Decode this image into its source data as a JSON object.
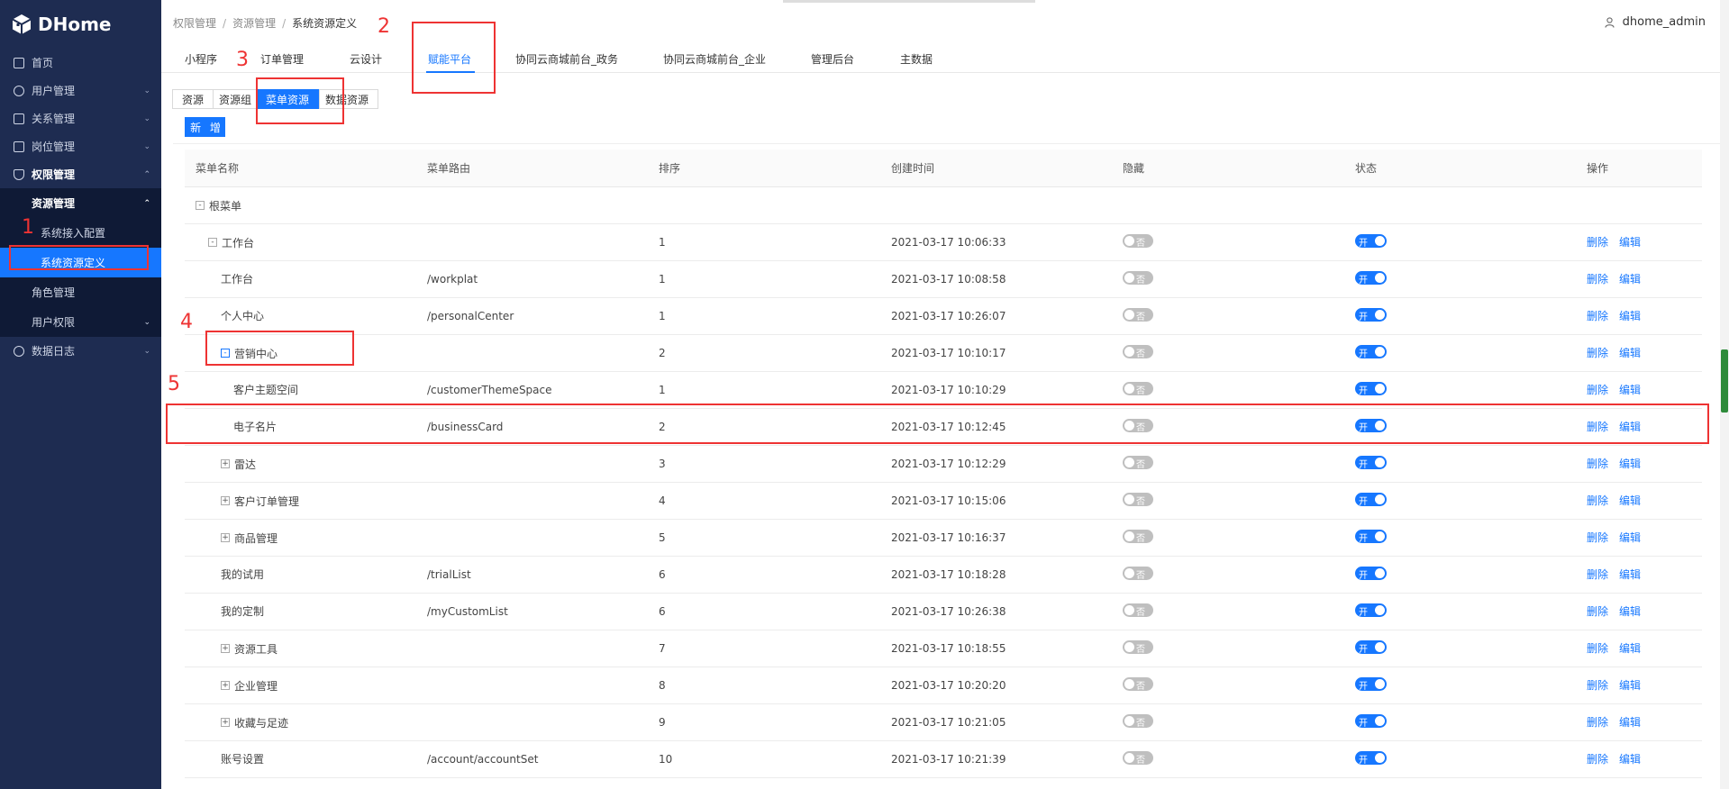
{
  "app": {
    "name": "DHome"
  },
  "sidebar": {
    "items": [
      {
        "label": "首页"
      },
      {
        "label": "用户管理"
      },
      {
        "label": "关系管理"
      },
      {
        "label": "岗位管理"
      },
      {
        "label": "权限管理"
      }
    ],
    "resource_mgmt": "资源管理",
    "sys_access": "系统接入配置",
    "sys_resource": "系统资源定义",
    "role_mgmt": "角色管理",
    "user_perm": "用户权限",
    "data_log": "数据日志"
  },
  "breadcrumb": {
    "a": "权限管理",
    "b": "资源管理",
    "c": "系统资源定义",
    "sep": "/"
  },
  "user": {
    "name": "dhome_admin"
  },
  "tabs": [
    "小程序",
    "订单管理",
    "云设计",
    "赋能平台",
    "协同云商城前台_政务",
    "协同云商城前台_企业",
    "管理后台",
    "主数据"
  ],
  "subtabs": [
    "资源",
    "资源组",
    "菜单资源",
    "数据资源"
  ],
  "add_button": "新 增",
  "table": {
    "headers": [
      "菜单名称",
      "菜单路由",
      "排序",
      "创建时间",
      "隐藏",
      "状态",
      "操作"
    ],
    "rows": [
      {
        "name": "根菜单",
        "route": "",
        "order": "",
        "time": "",
        "exp": "-"
      },
      {
        "name": "工作台",
        "route": "",
        "order": "1",
        "time": "2021-03-17 10:06:33",
        "exp": "-"
      },
      {
        "name": "工作台",
        "route": "/workplat",
        "order": "1",
        "time": "2021-03-17 10:08:58"
      },
      {
        "name": "个人中心",
        "route": "/personalCenter",
        "order": "1",
        "time": "2021-03-17 10:26:07"
      },
      {
        "name": "营销中心",
        "route": "",
        "order": "2",
        "time": "2021-03-17 10:10:17",
        "exp": "-"
      },
      {
        "name": "客户主题空间",
        "route": "/customerThemeSpace",
        "order": "1",
        "time": "2021-03-17 10:10:29"
      },
      {
        "name": "电子名片",
        "route": "/businessCard",
        "order": "2",
        "time": "2021-03-17 10:12:45"
      },
      {
        "name": "雷达",
        "route": "",
        "order": "3",
        "time": "2021-03-17 10:12:29",
        "exp": "+"
      },
      {
        "name": "客户订单管理",
        "route": "",
        "order": "4",
        "time": "2021-03-17 10:15:06",
        "exp": "+"
      },
      {
        "name": "商品管理",
        "route": "",
        "order": "5",
        "time": "2021-03-17 10:16:37",
        "exp": "+"
      },
      {
        "name": "我的试用",
        "route": "/trialList",
        "order": "6",
        "time": "2021-03-17 10:18:28"
      },
      {
        "name": "我的定制",
        "route": "/myCustomList",
        "order": "6",
        "time": "2021-03-17 10:26:38"
      },
      {
        "name": "资源工具",
        "route": "",
        "order": "7",
        "time": "2021-03-17 10:18:55",
        "exp": "+"
      },
      {
        "name": "企业管理",
        "route": "",
        "order": "8",
        "time": "2021-03-17 10:20:20",
        "exp": "+"
      },
      {
        "name": "收藏与足迹",
        "route": "",
        "order": "9",
        "time": "2021-03-17 10:21:05",
        "exp": "+"
      },
      {
        "name": "账号设置",
        "route": "/account/accountSet",
        "order": "10",
        "time": "2021-03-17 10:21:39"
      }
    ],
    "hide_label": "否",
    "status_label": "开",
    "delete_label": "删除",
    "edit_label": "编辑"
  },
  "annotations": [
    "1",
    "2",
    "3",
    "4",
    "5"
  ],
  "colors": {
    "sidebar": "#1e2c51",
    "accent": "#1677ff",
    "annotation": "#e33"
  }
}
